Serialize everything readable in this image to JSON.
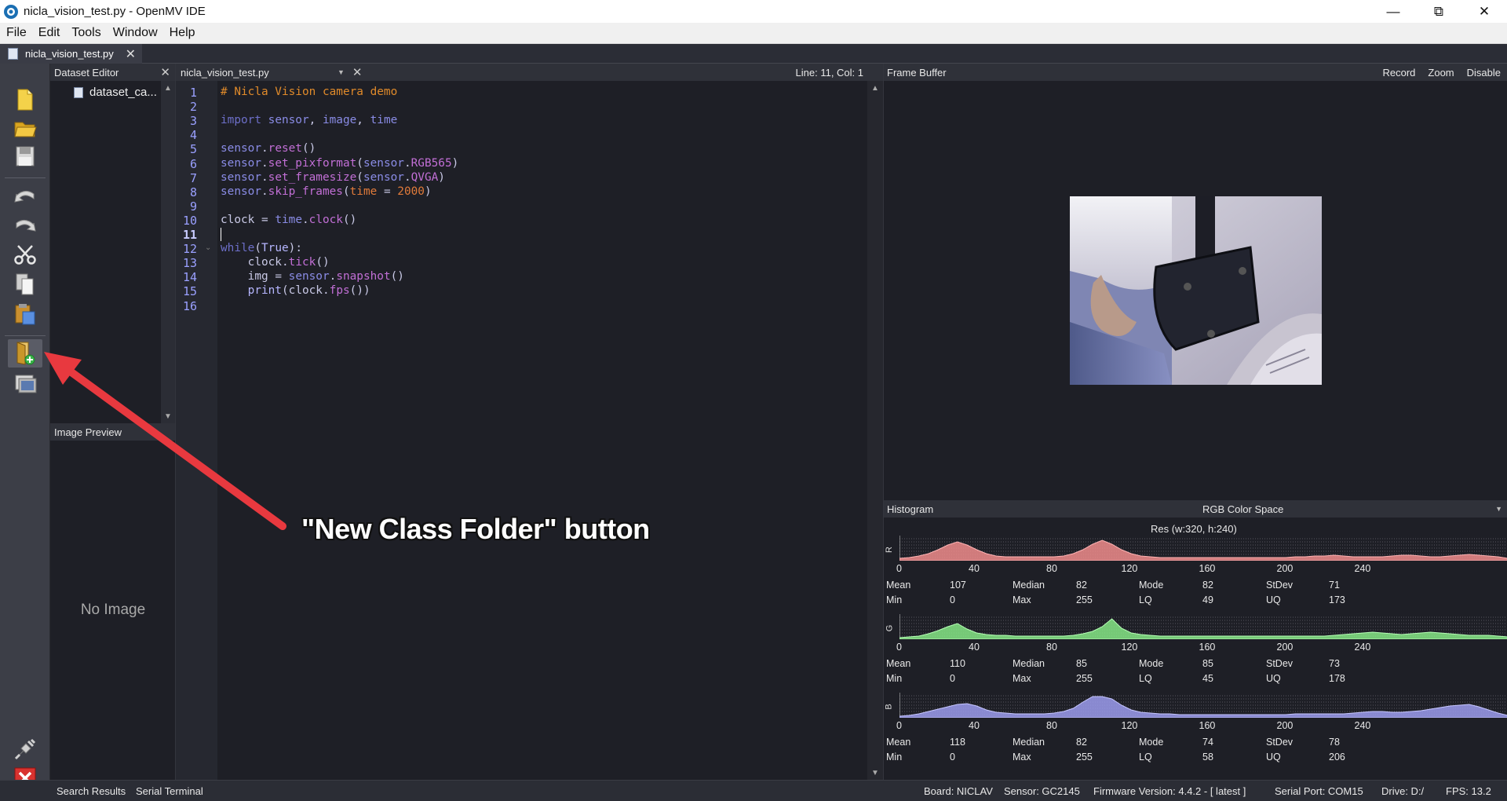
{
  "window": {
    "title": "nicla_vision_test.py - OpenMV IDE",
    "icon": "openmv-logo-icon",
    "controls": {
      "minimize": "—",
      "restore": "⧉",
      "close": "✕"
    }
  },
  "menu": [
    {
      "label": "File",
      "accel": "F"
    },
    {
      "label": "Edit",
      "accel": "E"
    },
    {
      "label": "Tools",
      "accel": "T"
    },
    {
      "label": "Window",
      "accel": "W"
    },
    {
      "label": "Help",
      "accel": "H"
    }
  ],
  "file_tab": {
    "label": "nicla_vision_test.py",
    "close": "✕"
  },
  "toolbar": {
    "icons": [
      "new-file-icon",
      "open-folder-icon",
      "save-icon",
      "undo-icon",
      "redo-icon",
      "cut-icon",
      "copy-icon",
      "paste-icon",
      "new-class-folder-icon",
      "snapshot-icon",
      "connect-icon",
      "disconnect-icon"
    ]
  },
  "dataset_editor": {
    "title": "Dataset Editor",
    "close": "✕",
    "items": [
      "dataset_ca..."
    ]
  },
  "image_preview": {
    "title": "Image Preview",
    "empty_text": "No Image"
  },
  "editor": {
    "filename": "nicla_vision_test.py",
    "dropdown": "▼",
    "close": "✕",
    "cursor_position": "Line: 11, Col: 1",
    "current_line": 11,
    "fold_line": 12,
    "lines": [
      [
        {
          "t": "# Nicla Vision camera demo",
          "c": "comment"
        }
      ],
      [],
      [
        {
          "t": "import",
          "c": "keyword"
        },
        {
          "t": " ",
          "c": "plain"
        },
        {
          "t": "sensor",
          "c": "module"
        },
        {
          "t": ", ",
          "c": "plain"
        },
        {
          "t": "image",
          "c": "module"
        },
        {
          "t": ", ",
          "c": "plain"
        },
        {
          "t": "time",
          "c": "module"
        }
      ],
      [],
      [
        {
          "t": "sensor",
          "c": "module"
        },
        {
          "t": ".",
          "c": "plain"
        },
        {
          "t": "reset",
          "c": "func"
        },
        {
          "t": "()",
          "c": "plain"
        }
      ],
      [
        {
          "t": "sensor",
          "c": "module"
        },
        {
          "t": ".",
          "c": "plain"
        },
        {
          "t": "set_pixformat",
          "c": "func"
        },
        {
          "t": "(",
          "c": "plain"
        },
        {
          "t": "sensor",
          "c": "module"
        },
        {
          "t": ".",
          "c": "plain"
        },
        {
          "t": "RGB565",
          "c": "func"
        },
        {
          "t": ")",
          "c": "plain"
        }
      ],
      [
        {
          "t": "sensor",
          "c": "module"
        },
        {
          "t": ".",
          "c": "plain"
        },
        {
          "t": "set_framesize",
          "c": "func"
        },
        {
          "t": "(",
          "c": "plain"
        },
        {
          "t": "sensor",
          "c": "module"
        },
        {
          "t": ".",
          "c": "plain"
        },
        {
          "t": "QVGA",
          "c": "func"
        },
        {
          "t": ")",
          "c": "plain"
        }
      ],
      [
        {
          "t": "sensor",
          "c": "module"
        },
        {
          "t": ".",
          "c": "plain"
        },
        {
          "t": "skip_frames",
          "c": "func"
        },
        {
          "t": "(",
          "c": "plain"
        },
        {
          "t": "time",
          "c": "number"
        },
        {
          "t": " = ",
          "c": "plain"
        },
        {
          "t": "2000",
          "c": "number"
        },
        {
          "t": ")",
          "c": "plain"
        }
      ],
      [],
      [
        {
          "t": "clock",
          "c": "plain"
        },
        {
          "t": " = ",
          "c": "plain"
        },
        {
          "t": "time",
          "c": "module"
        },
        {
          "t": ".",
          "c": "plain"
        },
        {
          "t": "clock",
          "c": "func"
        },
        {
          "t": "()",
          "c": "plain"
        }
      ],
      [],
      [
        {
          "t": "while",
          "c": "keyword"
        },
        {
          "t": "(",
          "c": "plain"
        },
        {
          "t": "True",
          "c": "builtin"
        },
        {
          "t": "):",
          "c": "plain"
        }
      ],
      [
        {
          "t": "    clock",
          "c": "plain"
        },
        {
          "t": ".",
          "c": "plain"
        },
        {
          "t": "tick",
          "c": "func"
        },
        {
          "t": "()",
          "c": "plain"
        }
      ],
      [
        {
          "t": "    img",
          "c": "plain"
        },
        {
          "t": " = ",
          "c": "plain"
        },
        {
          "t": "sensor",
          "c": "module"
        },
        {
          "t": ".",
          "c": "plain"
        },
        {
          "t": "snapshot",
          "c": "func"
        },
        {
          "t": "()",
          "c": "plain"
        }
      ],
      [
        {
          "t": "    print",
          "c": "builtin"
        },
        {
          "t": "(",
          "c": "plain"
        },
        {
          "t": "clock",
          "c": "plain"
        },
        {
          "t": ".",
          "c": "plain"
        },
        {
          "t": "fps",
          "c": "func"
        },
        {
          "t": "())",
          "c": "plain"
        }
      ],
      []
    ],
    "colors": {
      "comment": "#e08a2a",
      "keyword": "#6d6fc9",
      "module": "#8a8ce6",
      "func": "#c26fd6",
      "builtin": "#b6b6ff",
      "number": "#e07a3a",
      "plain": "#c9c9e6"
    }
  },
  "frame_buffer": {
    "title": "Frame Buffer",
    "actions": [
      "Record",
      "Zoom",
      "Disable"
    ]
  },
  "histogram": {
    "title": "Histogram",
    "color_space": "RGB Color Space",
    "dropdown": "▼",
    "resolution": "Res (w:320, h:240)",
    "ticks": [
      "0",
      "40",
      "80",
      "120",
      "160",
      "200",
      "240"
    ],
    "channels": [
      {
        "label": "R",
        "color": "#f08c8c",
        "stroke": "#ffb3b3",
        "profile": [
          3,
          4,
          6,
          9,
          14,
          20,
          24,
          20,
          14,
          9,
          6,
          5,
          5,
          5,
          5,
          5,
          5,
          6,
          9,
          14,
          21,
          26,
          21,
          14,
          9,
          6,
          5,
          4,
          4,
          4,
          4,
          4,
          4,
          4,
          4,
          4,
          4,
          4,
          4,
          4,
          4,
          5,
          5,
          6,
          6,
          7,
          6,
          5,
          5,
          5,
          5,
          6,
          7,
          7,
          6,
          5,
          5,
          6,
          7,
          8,
          7,
          6,
          5,
          3
        ],
        "stats": {
          "Mean": "107",
          "Median": "82",
          "Mode": "82",
          "StDev": "71",
          "Min": "0",
          "Max": "255",
          "LQ": "49",
          "UQ": "173"
        }
      },
      {
        "label": "G",
        "color": "#86e886",
        "stroke": "#b5ffb5",
        "profile": [
          2,
          3,
          4,
          7,
          11,
          16,
          20,
          13,
          8,
          6,
          5,
          5,
          4,
          4,
          4,
          4,
          4,
          4,
          5,
          7,
          10,
          16,
          26,
          14,
          8,
          6,
          5,
          4,
          4,
          4,
          4,
          4,
          4,
          4,
          4,
          4,
          4,
          4,
          4,
          4,
          4,
          4,
          4,
          4,
          4,
          5,
          6,
          7,
          8,
          9,
          8,
          7,
          6,
          7,
          8,
          9,
          8,
          7,
          6,
          5,
          5,
          5,
          4,
          3
        ],
        "stats": {
          "Mean": "110",
          "Median": "85",
          "Mode": "85",
          "StDev": "73",
          "Min": "0",
          "Max": "255",
          "LQ": "45",
          "UQ": "178"
        }
      },
      {
        "label": "B",
        "color": "#9c9cee",
        "stroke": "#c6c6ff",
        "profile": [
          2,
          3,
          5,
          8,
          11,
          14,
          17,
          18,
          15,
          10,
          7,
          6,
          5,
          5,
          5,
          5,
          6,
          8,
          12,
          20,
          27,
          27,
          24,
          16,
          10,
          7,
          6,
          5,
          5,
          4,
          4,
          4,
          4,
          4,
          4,
          4,
          4,
          4,
          4,
          4,
          4,
          5,
          5,
          5,
          5,
          5,
          5,
          6,
          7,
          8,
          8,
          7,
          7,
          8,
          9,
          11,
          13,
          15,
          16,
          17,
          14,
          10,
          6,
          3
        ],
        "stats": {
          "Mean": "118",
          "Median": "82",
          "Mode": "74",
          "StDev": "78",
          "Min": "0",
          "Max": "255",
          "LQ": "58",
          "UQ": "206"
        }
      }
    ]
  },
  "bottom_tabs": [
    "Search Results",
    "Serial Terminal"
  ],
  "status": {
    "board": "Board: NICLAV",
    "sensor": "Sensor: GC2145",
    "firmware": "Firmware Version: 4.4.2 - [ latest ]",
    "serial_port": "Serial Port: COM15",
    "drive": "Drive: D:/",
    "fps": "FPS:  13.2"
  },
  "annotation": {
    "text": "\"New Class Folder\" button",
    "color": "#e8393f"
  }
}
